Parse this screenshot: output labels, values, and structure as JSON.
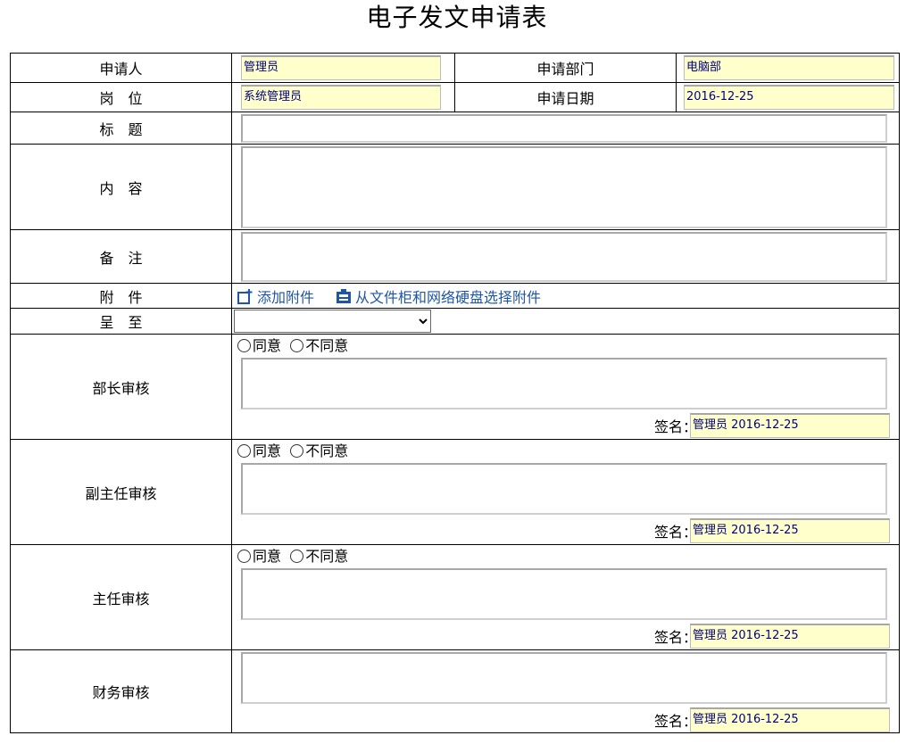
{
  "title": "电子发文申请表",
  "labels": {
    "applicant": "申请人",
    "department": "申请部门",
    "position": "岗　位",
    "apply_date": "申请日期",
    "subject": "标　题",
    "content": "内　容",
    "remark": "备　注",
    "attachment": "附　件",
    "submit_to": "呈　至",
    "dept_head_review": "部长审核",
    "deputy_director_review": "副主任审核",
    "director_review": "主任审核",
    "finance_review": "财务审核",
    "signature": "签名："
  },
  "values": {
    "applicant": "管理员",
    "department": "电脑部",
    "position": "系统管理员",
    "apply_date": "2016-12-25",
    "subject": "",
    "content": "",
    "remark": "",
    "submit_to": ""
  },
  "attachment_actions": {
    "add": "添加附件",
    "from_cabinet": "从文件柜和网络硬盘选择附件"
  },
  "review_options": {
    "agree": "同意",
    "disagree": "不同意"
  },
  "signatures": {
    "dept_head": "管理员 2016-12-25",
    "deputy_director": "管理员 2016-12-25",
    "director": "管理员 2016-12-25",
    "finance": "管理员 2016-12-25"
  },
  "colors": {
    "field_bg": "#ffffcc",
    "field_text": "#00007f",
    "link": "#1f55a8"
  },
  "icons": {
    "add_attachment": "add-attachment-icon",
    "select_attachment": "file-cabinet-icon"
  }
}
